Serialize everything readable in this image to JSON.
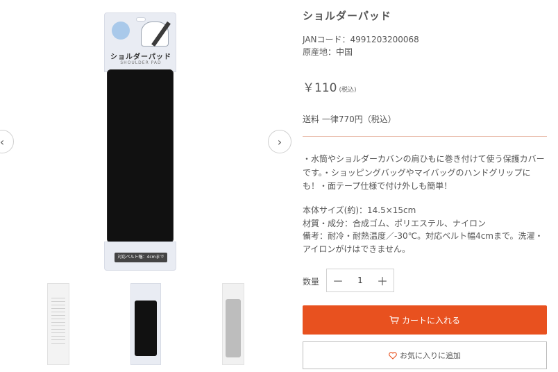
{
  "gallery": {
    "main_image": {
      "package_title": "ショルダーパッド",
      "package_subtitle": "SHOULDER PAD",
      "belt_label": "対応ベルト幅：4cmまで"
    },
    "prev_icon": "‹",
    "next_icon": "›",
    "thumbnail_count": 3
  },
  "product": {
    "title": "ショルダーパッド",
    "jan": "JANコード：4991203200068",
    "origin": "原産地：中国",
    "price": "￥110",
    "tax_note": "(税込)",
    "shipping": "送料 一律770円（税込）",
    "description": "・水筒やショルダーカバンの肩ひもに巻き付けて使う保護カバーです。・ショッピングバッグやマイバッグのハンドグリップにも！・面テープ仕様で付け外しも簡単！",
    "specs": [
      "本体サイズ(約)：14.5×15cm",
      "材質・成分：合成ゴム、ポリエステル、ナイロン",
      "備考：耐冷・耐熱温度／-30℃。対応ベルト幅4cmまで。洗濯・アイロンがけはできません。"
    ]
  },
  "quantity": {
    "label": "数量",
    "value": "1",
    "decrement": "－",
    "increment": "＋"
  },
  "buttons": {
    "cart": "カートに入れる",
    "favorite": "お気に入りに追加"
  },
  "colors": {
    "accent": "#e8511f",
    "divider": "#e8b9a6",
    "pad": "#111111"
  },
  "icons": [
    "chevron-left-icon",
    "chevron-right-icon",
    "cart-icon",
    "heart-icon"
  ]
}
